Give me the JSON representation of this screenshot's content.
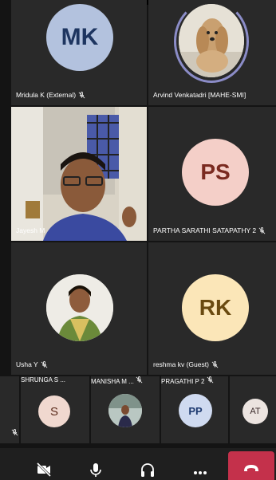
{
  "participants": {
    "mridula": {
      "initials": "MK",
      "name": "Mridula K (External)"
    },
    "arvind": {
      "name": "Arvind Venkatadri [MAHE-SMI]"
    },
    "jayesh": {
      "name": "Jayesh M"
    },
    "partha": {
      "initials": "PS",
      "name": "PARTHA SARATHI SATAPATHY 2"
    },
    "usha": {
      "name": "Usha Y"
    },
    "reshma": {
      "initials": "RK",
      "name": "reshma kv (Guest)"
    }
  },
  "strip": {
    "shrunga": {
      "initials": "S",
      "name": "SHRUNGA S ..."
    },
    "manisha": {
      "name": "MANISHA M ..."
    },
    "pragathi": {
      "initials": "PP",
      "name": "PRAGATHI P 2"
    },
    "at": {
      "initials": "AT"
    }
  },
  "toolbar": {
    "icons": [
      "video-off-icon",
      "microphone-icon",
      "headphones-icon",
      "more-icon",
      "hang-up-icon"
    ]
  },
  "colors": {
    "tile": "#292929",
    "end_call": "#c4314b",
    "active_speaker_ring": "#8b8cc7"
  }
}
